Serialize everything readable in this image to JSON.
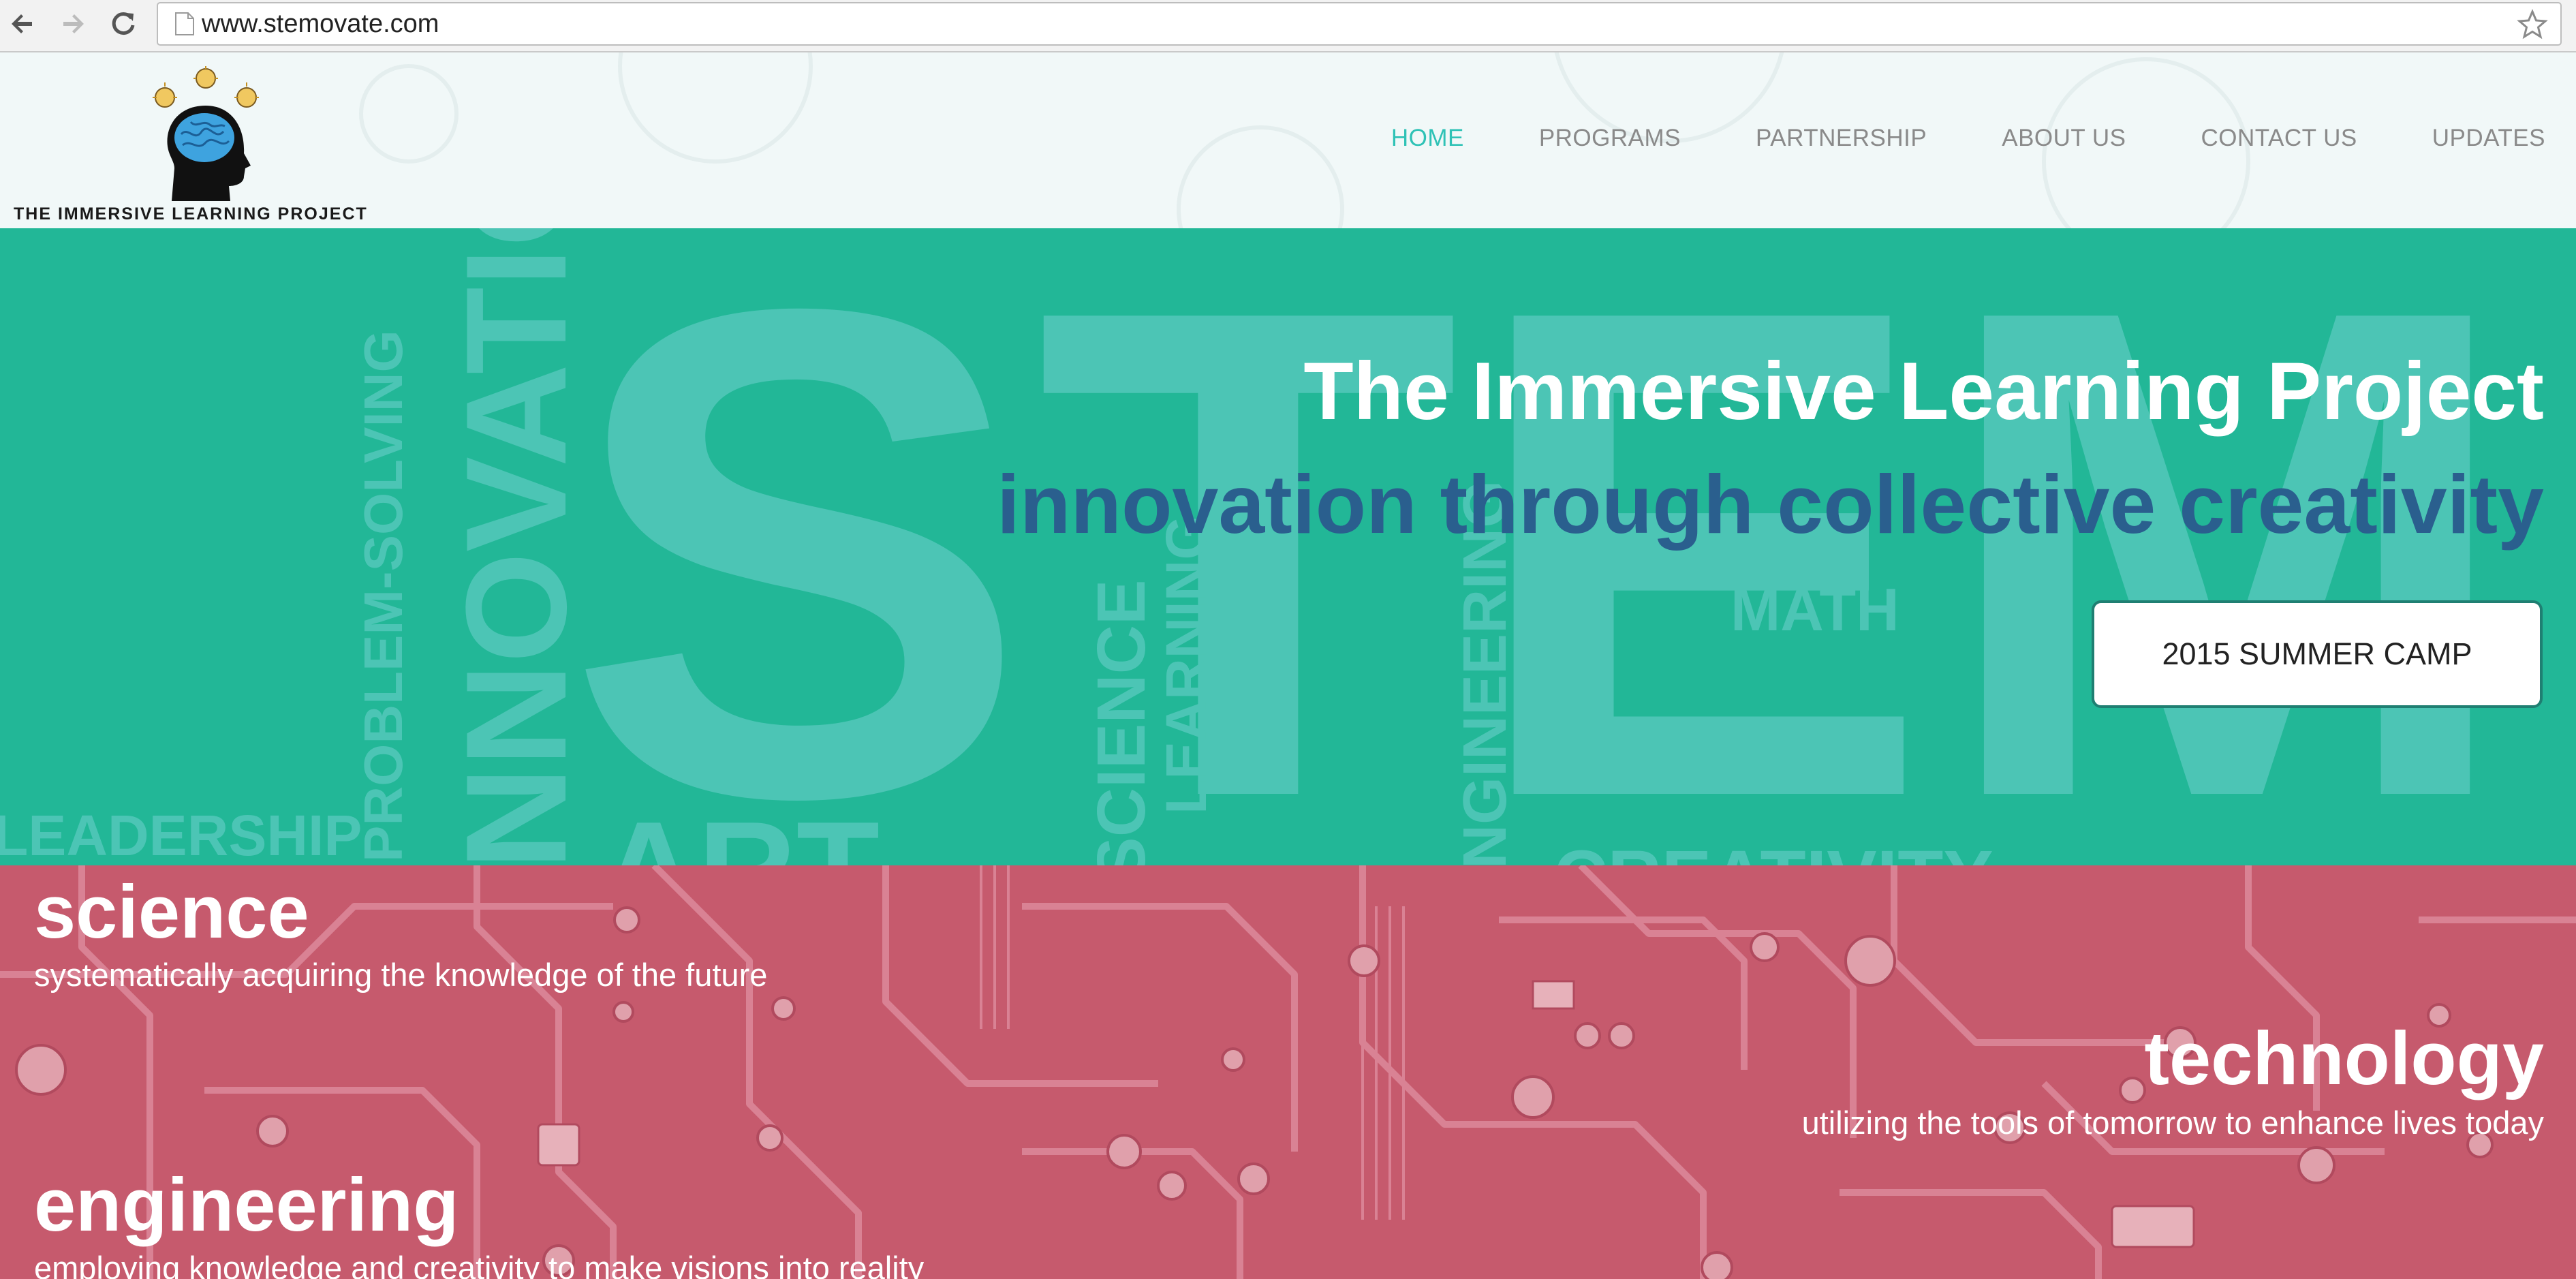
{
  "browser": {
    "url": "www.stemovate.com",
    "icons": [
      "back-arrow-icon",
      "forward-arrow-icon",
      "reload-icon",
      "page-icon",
      "star-icon"
    ]
  },
  "header": {
    "logo_text": "THE IMMERSIVE LEARNING PROJECT",
    "nav": [
      {
        "label": "HOME",
        "active": true
      },
      {
        "label": "PROGRAMS",
        "active": false
      },
      {
        "label": "PARTNERSHIP",
        "active": false
      },
      {
        "label": "ABOUT US",
        "active": false
      },
      {
        "label": "CONTACT US",
        "active": false
      },
      {
        "label": "UPDATES",
        "active": false
      }
    ]
  },
  "hero": {
    "title": "The Immersive Learning Project",
    "subtitle": "innovation through collective creativity",
    "cta_label": "2015 SUMMER CAMP",
    "background_words": [
      "STEM",
      "INNOVATION",
      "PROBLEM-SOLVING",
      "LEADERSHIP",
      "ART",
      "SCIENCE",
      "LEARNING",
      "ENGINEERING",
      "MATH",
      "CREATIVITY"
    ]
  },
  "topics": [
    {
      "title": "science",
      "description": "systematically acquiring the knowledge of the future"
    },
    {
      "title": "technology",
      "description": "utilizing the tools of tomorrow to enhance lives today"
    },
    {
      "title": "engineering",
      "description": "employing knowledge and creativity to make visions into reality"
    }
  ],
  "colors": {
    "hero_bg": "#22b797",
    "hero_subtitle": "#2a5f8e",
    "nav_active": "#2fc2b6",
    "circuit_bg": "#c65a6d"
  }
}
